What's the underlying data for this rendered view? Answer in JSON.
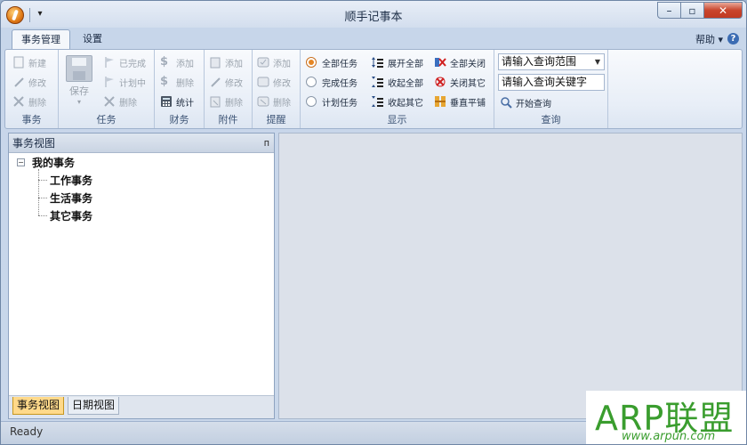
{
  "window": {
    "title": "顺手记事本"
  },
  "tabs": [
    {
      "label": "事务管理",
      "active": true
    },
    {
      "label": "设置",
      "active": false
    }
  ],
  "help": {
    "label": "帮助",
    "arrow": "▾"
  },
  "ribbon": {
    "groups": {
      "shiwu": {
        "label": "事务",
        "items": [
          "新建",
          "修改",
          "删除"
        ]
      },
      "renwu": {
        "label": "任务",
        "save": "保存",
        "items": [
          "已完成",
          "计划中",
          "删除"
        ]
      },
      "caiwu": {
        "label": "财务",
        "items": [
          "添加",
          "删除",
          "统计"
        ]
      },
      "fujian": {
        "label": "附件",
        "items": [
          "添加",
          "修改",
          "删除"
        ]
      },
      "tixing": {
        "label": "提醒",
        "items": [
          "添加",
          "修改",
          "删除"
        ]
      },
      "xianshi": {
        "label": "显示",
        "radios": [
          {
            "label": "全部任务",
            "selected": true
          },
          {
            "label": "完成任务",
            "selected": false
          },
          {
            "label": "计划任务",
            "selected": false
          }
        ],
        "buttons": [
          "展开全部",
          "收起全部",
          "收起其它",
          "全部关闭",
          "关闭其它",
          "垂直平铺"
        ]
      },
      "chaxun": {
        "label": "查询",
        "range_value": "请输入查询范围",
        "keyword_value": "请输入查询关键字",
        "search_label": "开始查询"
      }
    }
  },
  "left_panel": {
    "title": "事务视图",
    "pin": "ᴨ",
    "tree": {
      "root": "我的事务",
      "children": [
        "工作事务",
        "生活事务",
        "其它事务"
      ]
    },
    "bottom_tabs": [
      "事务视图",
      "日期视图"
    ]
  },
  "status": {
    "text": "Ready"
  },
  "watermark": {
    "text": "ARP联盟",
    "url": "www.arpun.com"
  },
  "icons": {
    "app": "app-logo-icon",
    "min": "minimize-icon",
    "max": "maximize-icon",
    "close": "close-icon"
  },
  "colors": {
    "accent": "#e58624",
    "tab_active": "#ffd98a",
    "watermark": "#3a9d2e"
  }
}
